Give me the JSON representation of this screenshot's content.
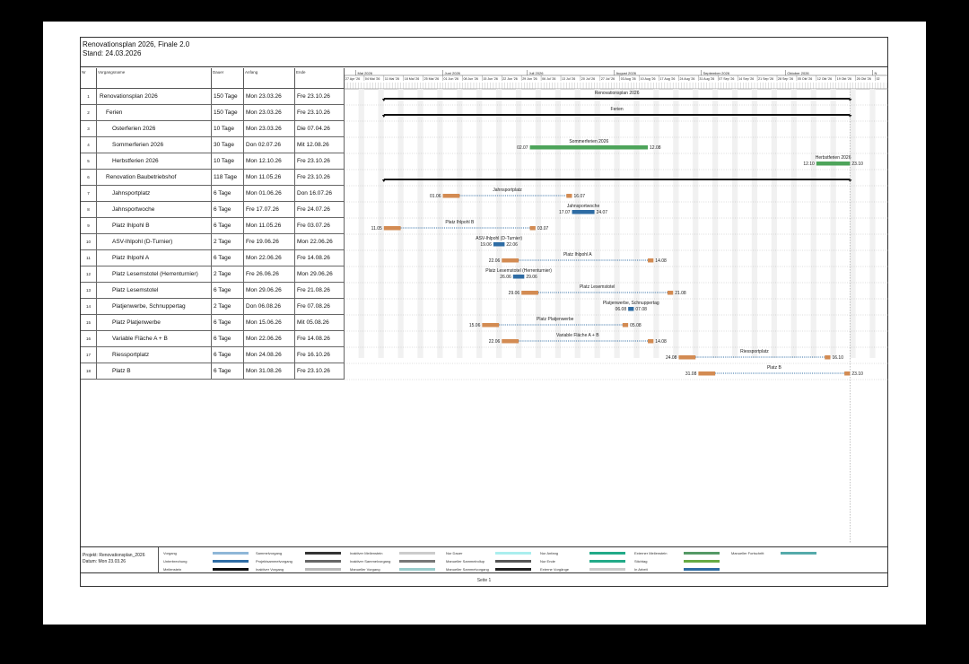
{
  "title": "Renovationsplan 2026, Finale 2.0",
  "stand": "Stand: 24.03.2026",
  "headers": {
    "nr": "Nr",
    "name": "Vorgangsname",
    "dauer": "Dauer",
    "anfang": "Anfang",
    "ende": "Ende"
  },
  "months": [
    "Mai 2026",
    "Juni 2026",
    "Juli 2026",
    "August 2026",
    "September 2026",
    "Oktober 2026",
    "N"
  ],
  "weeks": [
    "27 Apr '26",
    "04 Mai '26",
    "11 Mai '26",
    "18 Mai '26",
    "25 Mai '26",
    "01 Jun '26",
    "08 Jun '26",
    "15 Jun '26",
    "22 Jun '26",
    "29 Jun '26",
    "06 Jul '26",
    "13 Jul '26",
    "20 Jul '26",
    "27 Jul '26",
    "03 Aug '26",
    "10 Aug '26",
    "17 Aug '26",
    "24 Aug '26",
    "31 Aug '26",
    "07 Sep '26",
    "14 Sep '26",
    "21 Sep '26",
    "28 Sep '26",
    "05 Okt '26",
    "12 Okt '26",
    "19 Okt '26",
    "26 Okt '26",
    "02"
  ],
  "tasks": [
    {
      "id": "1",
      "name": "Renovationsplan 2026",
      "dauer": "150 Tage",
      "anfang": "Mon 23.03.26",
      "ende": "Fre 23.10.26",
      "indent": 0
    },
    {
      "id": "2",
      "name": "Ferien",
      "dauer": "150 Tage",
      "anfang": "Mon 23.03.26",
      "ende": "Fre 23.10.26",
      "indent": 1
    },
    {
      "id": "3",
      "name": "Osterferien 2026",
      "dauer": "10 Tage",
      "anfang": "Mon 23.03.26",
      "ende": "Die 07.04.26",
      "indent": 2
    },
    {
      "id": "4",
      "name": "Sommerferien 2026",
      "dauer": "30 Tage",
      "anfang": "Don 02.07.26",
      "ende": "Mit 12.08.26",
      "indent": 2
    },
    {
      "id": "5",
      "name": "Herbstferien 2026",
      "dauer": "10 Tage",
      "anfang": "Mon 12.10.26",
      "ende": "Fre 23.10.26",
      "indent": 2
    },
    {
      "id": "6",
      "name": "Renovation Baubetriebshof",
      "dauer": "118 Tage",
      "anfang": "Mon 11.05.26",
      "ende": "Fre 23.10.26",
      "indent": 1
    },
    {
      "id": "7",
      "name": "Jahnsportplatz",
      "dauer": "6 Tage",
      "anfang": "Mon 01.06.26",
      "ende": "Don 16.07.26",
      "indent": 2
    },
    {
      "id": "8",
      "name": "Jahnsportwoche",
      "dauer": "6 Tage",
      "anfang": "Fre 17.07.26",
      "ende": "Fre 24.07.26",
      "indent": 2
    },
    {
      "id": "9",
      "name": "Platz Ihlpohl B",
      "dauer": "6 Tage",
      "anfang": "Mon 11.05.26",
      "ende": "Fre 03.07.26",
      "indent": 2
    },
    {
      "id": "10",
      "name": "ASV-Ihlpohl (D-Turnier)",
      "dauer": "2 Tage",
      "anfang": "Fre 19.06.26",
      "ende": "Mon 22.06.26",
      "indent": 2
    },
    {
      "id": "11",
      "name": "Platz Ihlpohl A",
      "dauer": "6 Tage",
      "anfang": "Mon 22.06.26",
      "ende": "Fre 14.08.26",
      "indent": 2
    },
    {
      "id": "12",
      "name": "Platz Lesemstotel (Herrenturnier)",
      "dauer": "2 Tage",
      "anfang": "Fre 26.06.26",
      "ende": "Mon 29.06.26",
      "indent": 2
    },
    {
      "id": "13",
      "name": "Platz Lesemstotel",
      "dauer": "6 Tage",
      "anfang": "Mon 29.06.26",
      "ende": "Fre 21.08.26",
      "indent": 2
    },
    {
      "id": "14",
      "name": "Platjenwerbe, Schnuppertag",
      "dauer": "2 Tage",
      "anfang": "Don 06.08.26",
      "ende": "Fre 07.08.26",
      "indent": 2
    },
    {
      "id": "15",
      "name": "Platz Platjenwerbe",
      "dauer": "6 Tage",
      "anfang": "Mon 15.06.26",
      "ende": "Mit 05.08.26",
      "indent": 2
    },
    {
      "id": "16",
      "name": "Variable Fläche A + B",
      "dauer": "6 Tage",
      "anfang": "Mon 22.06.26",
      "ende": "Fre 14.08.26",
      "indent": 2
    },
    {
      "id": "17",
      "name": "Riessportplatz",
      "dauer": "6 Tage",
      "anfang": "Mon 24.08.26",
      "ende": "Fre 16.10.26",
      "indent": 2
    },
    {
      "id": "18",
      "name": "Platz B",
      "dauer": "6 Tage",
      "anfang": "Mon 31.08.26",
      "ende": "Fre 23.10.26",
      "indent": 2
    }
  ],
  "bars": [
    {
      "row": 0,
      "type": "summary",
      "start": "2026-05-11",
      "end": "2026-10-23",
      "label": "Renovationsplan 2026",
      "labelPos": "above"
    },
    {
      "row": 1,
      "type": "summary",
      "start": "2026-05-11",
      "end": "2026-10-23",
      "label": "Ferien",
      "labelPos": "above"
    },
    {
      "row": 3,
      "type": "green",
      "start": "2026-07-02",
      "end": "2026-08-12",
      "label": "Sommerferien 2026",
      "startLabel": "02.07",
      "endLabel": "12.08"
    },
    {
      "row": 4,
      "type": "green",
      "start": "2026-10-12",
      "end": "2026-10-23",
      "label": "Herbstferien 2026",
      "startLabel": "12.10",
      "endLabel": "23.10"
    },
    {
      "row": 5,
      "type": "summary",
      "start": "2026-05-11",
      "end": "2026-10-23"
    },
    {
      "row": 6,
      "type": "split",
      "start": "2026-06-01",
      "end": "2026-07-16",
      "label": "Jahnsportplatz",
      "startLabel": "01.06",
      "endLabel": "16.07"
    },
    {
      "row": 7,
      "type": "blue",
      "start": "2026-07-17",
      "end": "2026-07-24",
      "label": "Jahnsportwoche",
      "startLabel": "17.07",
      "endLabel": "24.07"
    },
    {
      "row": 8,
      "type": "split",
      "start": "2026-05-11",
      "end": "2026-07-03",
      "label": "Platz Ihlpohl B",
      "startLabel": "11.05",
      "endLabel": "03.07"
    },
    {
      "row": 9,
      "type": "blue",
      "start": "2026-06-19",
      "end": "2026-06-22",
      "label": "ASV-Ihlpohl (D-Turnier)",
      "startLabel": "19.06",
      "endLabel": "22.06"
    },
    {
      "row": 10,
      "type": "split",
      "start": "2026-06-22",
      "end": "2026-08-14",
      "label": "Platz Ihlpohl A",
      "startLabel": "22.06",
      "endLabel": "14.08"
    },
    {
      "row": 11,
      "type": "blue",
      "start": "2026-06-26",
      "end": "2026-06-29",
      "label": "Platz Lesemstotel (Herrenturnier)",
      "startLabel": "26.06",
      "endLabel": "29.06"
    },
    {
      "row": 12,
      "type": "split",
      "start": "2026-06-29",
      "end": "2026-08-21",
      "label": "Platz Lesemstotel",
      "startLabel": "29.06",
      "endLabel": "21.08"
    },
    {
      "row": 13,
      "type": "blue",
      "start": "2026-08-06",
      "end": "2026-08-07",
      "label": "Platjenwerbe, Schnuppertag",
      "startLabel": "06.08",
      "endLabel": "07.08"
    },
    {
      "row": 14,
      "type": "split",
      "start": "2026-06-15",
      "end": "2026-08-05",
      "label": "Platz Platjenwerbe",
      "startLabel": "15.06",
      "endLabel": "05.08"
    },
    {
      "row": 15,
      "type": "split",
      "start": "2026-06-22",
      "end": "2026-08-14",
      "label": "Variable Fläche A + B",
      "startLabel": "22.06",
      "endLabel": "14.08"
    },
    {
      "row": 16,
      "type": "split",
      "start": "2026-08-24",
      "end": "2026-10-16",
      "label": "Riessportplatz",
      "startLabel": "24.08",
      "endLabel": "16.10"
    },
    {
      "row": 17,
      "type": "split",
      "start": "2026-08-31",
      "end": "2026-10-23",
      "label": "Platz B",
      "startLabel": "31.08",
      "endLabel": "23.10"
    }
  ],
  "legend": {
    "project_line1": "Projekt: Renovationsplan_2026",
    "project_line2": "Datum: Mon 23.03.26",
    "items": [
      "Vorgang",
      "Unterbrechung",
      "Meilenstein",
      "Sammelvorgang",
      "Projektsammelvorgang",
      "Inaktiver Vorgang",
      "Inaktiver Meilenstein",
      "Inaktiver Sammelvorgang",
      "Manueller Vorgang",
      "Nur Dauer",
      "Manueller Sammelrollup",
      "Manueller Sammelvorgang",
      "Nur Anfang",
      "Nur Ende",
      "Externe Vorgänge",
      "Externer Meilenstein",
      "Stichtag",
      "In Arbeit",
      "Manueller Fortschritt"
    ]
  },
  "footer": "Seite 1",
  "colors": {
    "orange": "#d38b52",
    "blue": "#2e6ca4",
    "green": "#4da45a",
    "summary": "#111111"
  }
}
